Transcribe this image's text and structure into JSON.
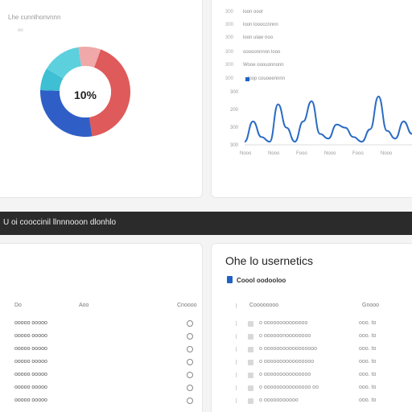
{
  "top_left": {
    "title": "Lhe cunnlhonvnnn",
    "subtitle": "oo",
    "donut": {
      "center_label": "10%",
      "segments": [
        {
          "name": "red",
          "value": 42,
          "color": "#df5a5a"
        },
        {
          "name": "blue",
          "value": 28,
          "color": "#2f5fc6"
        },
        {
          "name": "teal",
          "value": 8,
          "color": "#3ebfd3"
        },
        {
          "name": "cyan",
          "value": 14,
          "color": "#5dd0de"
        },
        {
          "name": "pink",
          "value": 8,
          "color": "#f0a8a8"
        }
      ]
    }
  },
  "top_right": {
    "legend": [
      {
        "key": "300",
        "label": "loon ooor"
      },
      {
        "key": "300",
        "label": "loon loooccnnnn"
      },
      {
        "key": "300",
        "label": "loon ulaw noo"
      },
      {
        "key": "300",
        "label": "ooooonnnnn looo"
      },
      {
        "key": "300",
        "label": "Wooe ooouonnonn"
      },
      {
        "key": "300",
        "label": "loop couoeennnn"
      }
    ],
    "chart_data": {
      "type": "line",
      "y_ticks": [
        "300",
        "200",
        "300",
        "300"
      ],
      "x_ticks": [
        "Nooo",
        "Nooo",
        "Fooo",
        "Nooo",
        "Fooo",
        "Nooo"
      ],
      "series": [
        {
          "color": "#2b6cc4",
          "values": [
            2,
            28,
            8,
            2,
            50,
            20,
            2,
            28,
            54,
            12,
            6,
            24,
            20,
            8,
            2,
            18,
            60,
            16,
            6,
            28,
            12
          ]
        }
      ]
    }
  },
  "banner": {
    "text": "U oi cooccinil llnnnooon dlonhlo"
  },
  "bottom_left": {
    "headers": [
      "Do",
      "Aoo",
      "Cnoooo"
    ],
    "rows": [
      "ooooo ooooo",
      "ooooo ooooo",
      "ooooo ooooo",
      "ooooo ooooo",
      "ooooo ooooo",
      "ooooo ooooo",
      "ooooo ooooo"
    ]
  },
  "bottom_right": {
    "title": "Ohe lo usernetics",
    "subtitle": "Coool oodooloo",
    "headers": [
      "Coooooooo",
      "Gnooo"
    ],
    "rows": [
      {
        "label": "o oooooooooooooo",
        "value": "ooo. to"
      },
      {
        "label": "o oooooonoooooooo",
        "value": "ooo. to"
      },
      {
        "label": "o ooooooooooooooooo",
        "value": "ooo. to"
      },
      {
        "label": "o oooooooooooooooo",
        "value": "ooo. to"
      },
      {
        "label": "o ooooooooooooooo",
        "value": "ooo. to"
      },
      {
        "label": "o ooooooooooooooo oo",
        "value": "ooo. to"
      },
      {
        "label": "o ooooooooooo",
        "value": "ooo. to"
      }
    ]
  }
}
